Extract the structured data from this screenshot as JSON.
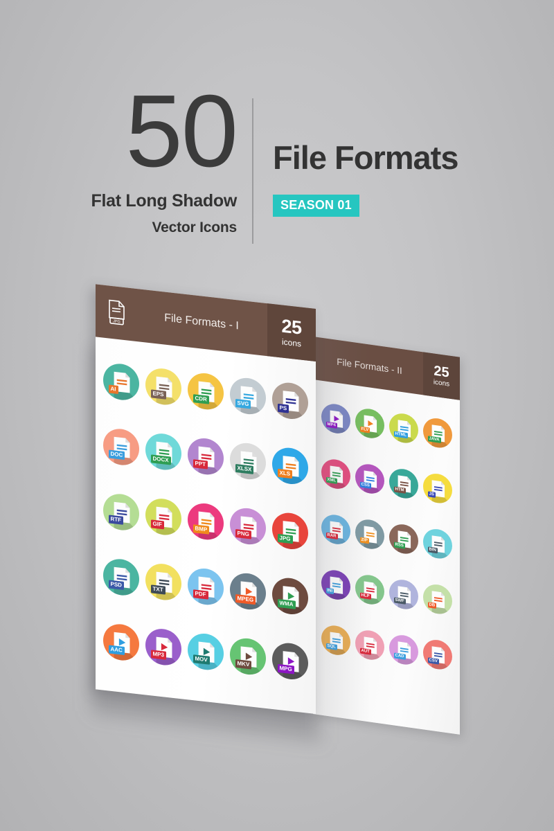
{
  "header": {
    "count": "50",
    "subtitle_line1": "Flat Long Shadow",
    "subtitle_line2": "Vector Icons",
    "title": "File Formats",
    "season_badge": "SEASON 01"
  },
  "panels": [
    {
      "id": "panel-left",
      "title": "File Formats - I",
      "count_number": "25",
      "count_word": "icons",
      "header_icon": "jpg-document-icon",
      "header_icon_label": "JPG",
      "bar_color": "#6f5347",
      "bar_count_color": "#5f463b",
      "columns": 5,
      "icons": [
        {
          "label": "AI",
          "circle": "#4bb5a1",
          "badge": "#e8762c",
          "lines": "#e8762c",
          "glyph": "doc"
        },
        {
          "label": "EPS",
          "circle": "#f4e06a",
          "badge": "#7a6257",
          "lines": "#7a6257",
          "glyph": "doc"
        },
        {
          "label": "CDR",
          "circle": "#f5c443",
          "badge": "#2f9e52",
          "lines": "#2f9e52",
          "glyph": "doc"
        },
        {
          "label": "SVG",
          "circle": "#c3ccd2",
          "badge": "#35a8e0",
          "lines": "#35a8e0",
          "glyph": "doc"
        },
        {
          "label": "PS",
          "circle": "#b0a096",
          "badge": "#2e3192",
          "lines": "#2e3192",
          "glyph": "doc"
        },
        {
          "label": "DOC",
          "circle": "#f79c83",
          "badge": "#3b9ede",
          "lines": "#3b9ede",
          "glyph": "doc"
        },
        {
          "label": "DOCX",
          "circle": "#6fd9d9",
          "badge": "#2f9e52",
          "lines": "#2f9e52",
          "glyph": "doc"
        },
        {
          "label": "PPT",
          "circle": "#b286cf",
          "badge": "#d8293b",
          "lines": "#d8293b",
          "glyph": "doc"
        },
        {
          "label": "XLSX",
          "circle": "#dcdcdc",
          "badge": "#2e7d60",
          "lines": "#2e7d60",
          "glyph": "doc"
        },
        {
          "label": "XLS",
          "circle": "#2fa8e8",
          "badge": "#ef7f1f",
          "lines": "#ef7f1f",
          "glyph": "doc"
        },
        {
          "label": "RTF",
          "circle": "#b4dd94",
          "badge": "#3a4a9e",
          "lines": "#3a4a9e",
          "glyph": "doc"
        },
        {
          "label": "GIF",
          "circle": "#d2de5c",
          "badge": "#d8293b",
          "lines": "#d8293b",
          "glyph": "doc"
        },
        {
          "label": "BMP",
          "circle": "#ec3a7e",
          "badge": "#f08a1c",
          "lines": "#f08a1c",
          "glyph": "doc"
        },
        {
          "label": "PNG",
          "circle": "#c88fd6",
          "badge": "#d8293b",
          "lines": "#d8293b",
          "glyph": "doc"
        },
        {
          "label": "JPG",
          "circle": "#e8453c",
          "badge": "#2f9e52",
          "lines": "#2f9e52",
          "glyph": "doc"
        },
        {
          "label": "PSD",
          "circle": "#4bb5a1",
          "badge": "#3b59a8",
          "lines": "#3b59a8",
          "glyph": "doc"
        },
        {
          "label": "TXT",
          "circle": "#f2e05f",
          "badge": "#3e4a56",
          "lines": "#3e4a56",
          "glyph": "doc"
        },
        {
          "label": "PDF",
          "circle": "#7cc4ef",
          "badge": "#d8293b",
          "lines": "#d8293b",
          "glyph": "doc"
        },
        {
          "label": "MPEG",
          "circle": "#6b7f8c",
          "badge": "#ef5a28",
          "lines": "#ef5a28",
          "glyph": "play"
        },
        {
          "label": "WMA",
          "circle": "#6e4b3f",
          "badge": "#2f9e52",
          "lines": "#2f9e52",
          "glyph": "play"
        },
        {
          "label": "AAC",
          "circle": "#f5793f",
          "badge": "#2f9ee0",
          "lines": "#2f9ee0",
          "glyph": "play"
        },
        {
          "label": "MP3",
          "circle": "#9a5fcb",
          "badge": "#d8293b",
          "lines": "#d8293b",
          "glyph": "play"
        },
        {
          "label": "MOV",
          "circle": "#57cfe3",
          "badge": "#1f7a70",
          "lines": "#1f7a70",
          "glyph": "play"
        },
        {
          "label": "MKV",
          "circle": "#66c473",
          "badge": "#6e4b3f",
          "lines": "#6e4b3f",
          "glyph": "play"
        },
        {
          "label": "MPG",
          "circle": "#5c5c5c",
          "badge": "#8c15c4",
          "lines": "#8c15c4",
          "glyph": "play"
        }
      ]
    },
    {
      "id": "panel-right",
      "title": "File Formats - II",
      "count_number": "25",
      "count_word": "icons",
      "bar_color": "#6a4e43",
      "bar_count_color": "#5d453b",
      "columns": 4,
      "icons": [
        {
          "label": "MP4",
          "circle": "#7a86c4",
          "badge": "#8c15c4",
          "lines": "#8c15c4",
          "glyph": "play"
        },
        {
          "label": "FLV",
          "circle": "#77be60",
          "badge": "#ef7f1f",
          "lines": "#ef7f1f",
          "glyph": "play"
        },
        {
          "label": "HTML",
          "circle": "#cada4c",
          "badge": "#2f9ee0",
          "lines": "#2f9ee0",
          "glyph": "doc"
        },
        {
          "label": "JAVA",
          "circle": "#f0993c",
          "badge": "#2f9e52",
          "lines": "#2f9e52",
          "glyph": "doc"
        },
        {
          "label": "XML",
          "circle": "#e44b7e",
          "badge": "#2f9e52",
          "lines": "#2f9e52",
          "glyph": "doc"
        },
        {
          "label": "CSS",
          "circle": "#b456bd",
          "badge": "#2f7fe0",
          "lines": "#2f7fe0",
          "glyph": "doc"
        },
        {
          "label": "HTM",
          "circle": "#39a899",
          "badge": "#7a5246",
          "lines": "#7a5246",
          "glyph": "doc"
        },
        {
          "label": "JS",
          "circle": "#f5dc3f",
          "badge": "#3a4ab8",
          "lines": "#3a4ab8",
          "glyph": "doc"
        },
        {
          "label": "RAR",
          "circle": "#6ab4e0",
          "badge": "#d8293b",
          "lines": "#d8293b",
          "glyph": "doc"
        },
        {
          "label": "ZIP",
          "circle": "#7f9aa3",
          "badge": "#ef9020",
          "lines": "#ef9020",
          "glyph": "doc"
        },
        {
          "label": "RSS",
          "circle": "#8a675a",
          "badge": "#2f9e52",
          "lines": "#2f9e52",
          "glyph": "doc"
        },
        {
          "label": "BIN",
          "circle": "#6fd3de",
          "badge": "#4a5a66",
          "lines": "#4a5a66",
          "glyph": "doc"
        },
        {
          "label": "INI",
          "circle": "#7a3fb5",
          "badge": "#3b9ede",
          "lines": "#3b9ede",
          "glyph": "doc"
        },
        {
          "label": "HLP",
          "circle": "#84c68c",
          "badge": "#d8293b",
          "lines": "#d8293b",
          "glyph": "doc"
        },
        {
          "label": "SWF",
          "circle": "#b0b4dd",
          "badge": "#4a5a66",
          "lines": "#4a5a66",
          "glyph": "doc"
        },
        {
          "label": "DB",
          "circle": "#c4e0a8",
          "badge": "#ef5a28",
          "lines": "#ef5a28",
          "glyph": "doc"
        },
        {
          "label": "SQL",
          "circle": "#e8ac52",
          "badge": "#3b9ede",
          "lines": "#3b9ede",
          "glyph": "doc"
        },
        {
          "label": "AUT",
          "circle": "#f0a0b4",
          "badge": "#d8293b",
          "lines": "#d8293b",
          "glyph": "doc"
        },
        {
          "label": "CAD",
          "circle": "#d89ade",
          "badge": "#3b9ede",
          "lines": "#3b9ede",
          "glyph": "doc"
        },
        {
          "label": "CSV",
          "circle": "#f07a74",
          "badge": "#3b59a8",
          "lines": "#3b59a8",
          "glyph": "doc"
        }
      ]
    }
  ],
  "colors": {
    "background": "#c4c4c6",
    "accent_teal": "#26c6c0",
    "text_dark": "#333333",
    "bar_brown": "#6f5347"
  }
}
